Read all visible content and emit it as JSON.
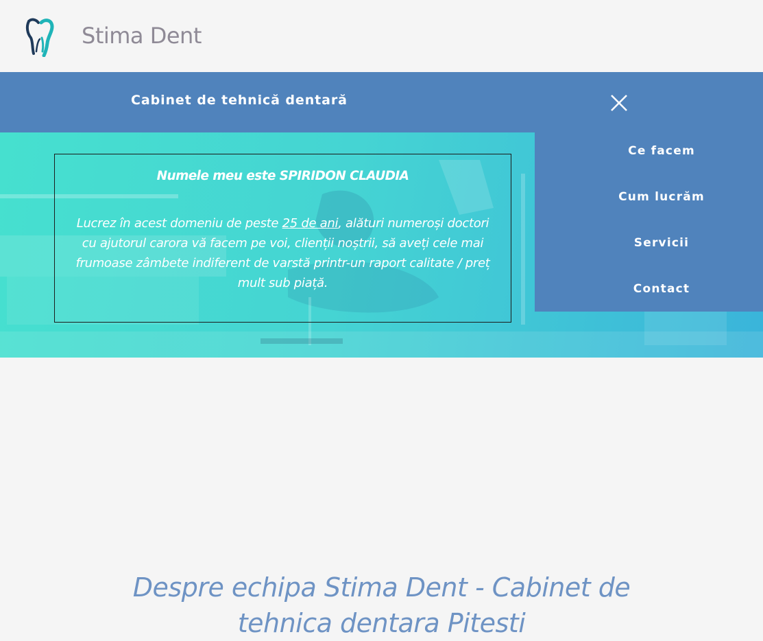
{
  "header": {
    "brand": "Stima Dent",
    "logo_icon": "tooth-icon"
  },
  "bar": {
    "title": "Cabinet de tehnică dentară",
    "close_icon": "close-icon"
  },
  "hero": {
    "card_title": "Numele meu este SPIRIDON CLAUDIA",
    "body_before": "Lucrez în acest domeniu de peste ",
    "body_link": "25 de ani",
    "body_after": ", alături numeroși doctori cu ajutorul carora vă facem pe voi, clienții noștrii, să aveți cele mai frumoase zâmbete indiferent de varstă printr-un raport calitate / preț mult sub piață."
  },
  "menu": {
    "items": [
      "Ce facem",
      "Cum lucrăm",
      "Servicii",
      "Contact"
    ]
  },
  "section": {
    "heading": "Despre echipa Stima Dent - Cabinet de tehnica dentara Pitesti"
  },
  "colors": {
    "nav_blue": "#5083bc",
    "hero_teal": "#46e0cf",
    "heading_blue": "#6e93c4",
    "brand_gray": "#8f8a96"
  }
}
